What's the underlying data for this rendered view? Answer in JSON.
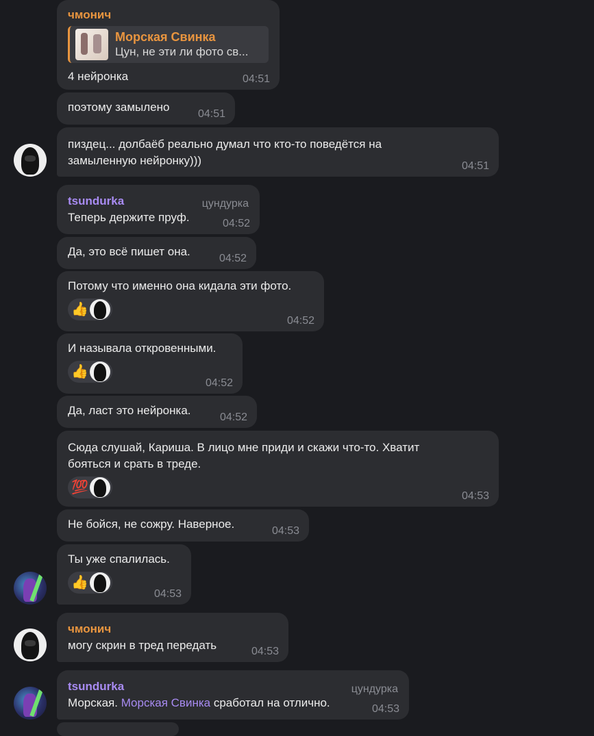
{
  "messages": [
    {
      "sender": "чмонич",
      "reply_title": "Морская Свинка",
      "reply_text": "Цун, не эти ли фото св...",
      "text": "4 нейронка",
      "time": "04:51"
    },
    {
      "text": "поэтому замылено",
      "time": "04:51"
    },
    {
      "text": "пиздец... долбаёб реально думал что кто-то поведётся на\nзамыленную нейронку)))",
      "time": "04:51"
    },
    {
      "sender": "tsundurka",
      "role": "цундурка",
      "text": "Теперь держите пруф.",
      "time": "04:52"
    },
    {
      "text": "Да, это всё пишет она.",
      "time": "04:52"
    },
    {
      "text": "Потому что именно она кидала эти фото.",
      "reaction": "👍",
      "time": "04:52"
    },
    {
      "text": "И называла откровенными.",
      "reaction": "👍",
      "time": "04:52"
    },
    {
      "text": "Да, ласт это нейронка.",
      "time": "04:52"
    },
    {
      "text": "Сюда слушай, Кариша. В лицо мне приди и скажи что-то. Хватит\nбояться и срать в треде.",
      "reaction": "💯",
      "time": "04:53"
    },
    {
      "text": "Не бойся, не сожру. Наверное.",
      "time": "04:53"
    },
    {
      "text": "Ты уже спалилась.",
      "reaction": "👍",
      "time": "04:53"
    },
    {
      "sender": "чмонич",
      "text": "могу скрин в тред передать",
      "time": "04:53"
    },
    {
      "sender": "tsundurka",
      "role": "цундурка",
      "text_before": "Морская. ",
      "mention": "Морская Свинка",
      "text_after": " сработал на отлично.",
      "time": "04:53"
    }
  ],
  "icons": {
    "hood_avatar": "hooded-figure-avatar",
    "anime_avatar": "anime-character-avatar",
    "thumbs_up": "thumbs-up-icon",
    "hundred": "hundred-points-icon"
  },
  "colors": {
    "background": "#1a1b1f",
    "bubble": "#2c2d31",
    "sender_orange": "#e9953f",
    "sender_purple": "#a88bf2",
    "time": "#8a8c93"
  }
}
